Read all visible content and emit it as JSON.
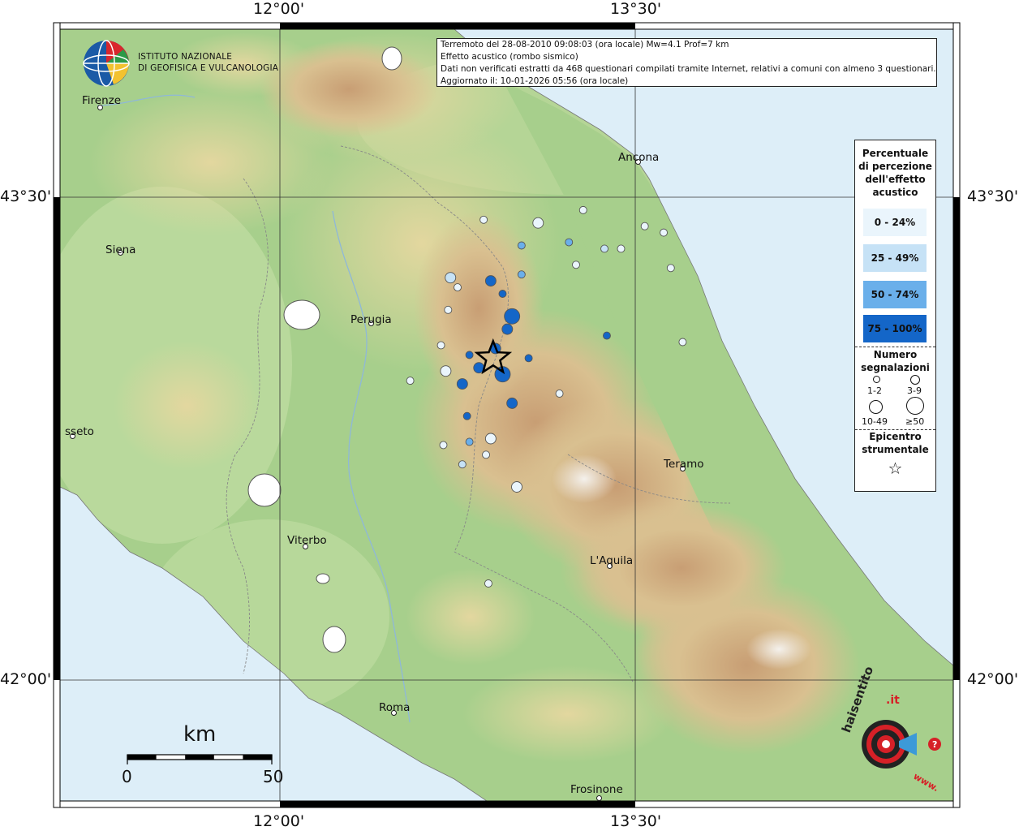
{
  "info": {
    "line1": "Terremoto del 28-08-2010 09:08:03 (ora locale) Mw=4.1 Prof=7 km",
    "line2": "Effetto acustico (rombo sismico)",
    "line3": "Dati non verificati estratti da 468 questionari compilati tramite Internet, relativi a comuni con almeno 3 questionari.",
    "line4": "Aggiornato il: 10-01-2026 05:56 (ora locale)"
  },
  "coords": {
    "top_left": "12°00'",
    "top_right": "13°30'",
    "bottom_left": "12°00'",
    "bottom_right": "13°30'",
    "left_top": "43°30'",
    "left_bottom": "42°00'",
    "right_top": "43°30'",
    "right_bottom": "42°00'"
  },
  "logo": {
    "line1": "ISTITUTO NAZIONALE",
    "line2": "DI GEOFISICA E VULCANOLOGIA"
  },
  "cities": {
    "firenze": "Firenze",
    "ancona": "Ancona",
    "siena": "Siena",
    "perugia": "Perugia",
    "grosseto": "sseto",
    "teramo": "Teramo",
    "viterbo": "Viterbo",
    "laquila": "L'Aquila",
    "roma": "Roma",
    "frosinone": "Frosinone"
  },
  "legend": {
    "title1": "Percentuale",
    "title2": "di percezione",
    "title3": "dell'effetto",
    "title4": "acustico",
    "classes": [
      {
        "label": "0 - 24%",
        "color": "#eaf5fc"
      },
      {
        "label": "25 - 49%",
        "color": "#c6e2f6"
      },
      {
        "label": "50 - 74%",
        "color": "#6aafea"
      },
      {
        "label": "75 - 100%",
        "color": "#1466c8"
      }
    ],
    "count_title1": "Numero",
    "count_title2": "segnalazioni",
    "count_labels": [
      "1-2",
      "3-9",
      "10-49",
      "≥50"
    ],
    "epi_title1": "Epicentro",
    "epi_title2": "strumentale",
    "star_glyph": "☆"
  },
  "scale": {
    "unit": "km",
    "min": "0",
    "max": "50"
  },
  "hsl": {
    "line1": "haisentito",
    "line2": "iltrerremoto",
    "domain": ".it",
    "prefix": "www."
  },
  "points": [
    {
      "lon": 12.94,
      "lat": 42.95,
      "pct": 100,
      "size": "large"
    },
    {
      "lon": 12.84,
      "lat": 42.97,
      "pct": 100,
      "size": "medium"
    },
    {
      "lon": 12.91,
      "lat": 43.03,
      "pct": 100,
      "size": "medium"
    },
    {
      "lon": 12.98,
      "lat": 43.13,
      "pct": 100,
      "size": "large"
    },
    {
      "lon": 12.96,
      "lat": 43.09,
      "pct": 100,
      "size": "medium"
    },
    {
      "lon": 12.98,
      "lat": 42.86,
      "pct": 100,
      "size": "medium"
    },
    {
      "lon": 12.89,
      "lat": 43.24,
      "pct": 100,
      "size": "medium"
    },
    {
      "lon": 13.05,
      "lat": 43.0,
      "pct": 100,
      "size": "small"
    },
    {
      "lon": 12.94,
      "lat": 43.2,
      "pct": 100,
      "size": "small"
    },
    {
      "lon": 12.8,
      "lat": 43.01,
      "pct": 100,
      "size": "small"
    },
    {
      "lon": 12.77,
      "lat": 42.92,
      "pct": 100,
      "size": "medium"
    },
    {
      "lon": 12.79,
      "lat": 42.82,
      "pct": 100,
      "size": "small"
    },
    {
      "lon": 13.38,
      "lat": 43.07,
      "pct": 100,
      "size": "small"
    },
    {
      "lon": 12.8,
      "lat": 42.74,
      "pct": 60,
      "size": "small"
    },
    {
      "lon": 13.02,
      "lat": 43.35,
      "pct": 60,
      "size": "small"
    },
    {
      "lon": 13.02,
      "lat": 43.26,
      "pct": 60,
      "size": "small"
    },
    {
      "lon": 13.22,
      "lat": 43.36,
      "pct": 60,
      "size": "small"
    },
    {
      "lon": 12.77,
      "lat": 42.67,
      "pct": 30,
      "size": "small"
    },
    {
      "lon": 12.72,
      "lat": 43.25,
      "pct": 30,
      "size": "medium"
    },
    {
      "lon": 13.37,
      "lat": 43.34,
      "pct": 30,
      "size": "small"
    },
    {
      "lon": 13.28,
      "lat": 43.46,
      "pct": 10,
      "size": "small"
    },
    {
      "lon": 12.86,
      "lat": 43.43,
      "pct": 10,
      "size": "small"
    },
    {
      "lon": 13.09,
      "lat": 43.42,
      "pct": 10,
      "size": "medium"
    },
    {
      "lon": 13.44,
      "lat": 43.34,
      "pct": 10,
      "size": "small"
    },
    {
      "lon": 13.54,
      "lat": 43.41,
      "pct": 10,
      "size": "small"
    },
    {
      "lon": 13.62,
      "lat": 43.39,
      "pct": 10,
      "size": "small"
    },
    {
      "lon": 13.25,
      "lat": 43.29,
      "pct": 10,
      "size": "small"
    },
    {
      "lon": 13.65,
      "lat": 43.28,
      "pct": 10,
      "size": "small"
    },
    {
      "lon": 12.75,
      "lat": 43.22,
      "pct": 10,
      "size": "small"
    },
    {
      "lon": 12.71,
      "lat": 43.15,
      "pct": 10,
      "size": "small"
    },
    {
      "lon": 12.68,
      "lat": 43.04,
      "pct": 10,
      "size": "small"
    },
    {
      "lon": 12.7,
      "lat": 42.96,
      "pct": 10,
      "size": "medium"
    },
    {
      "lon": 12.55,
      "lat": 42.93,
      "pct": 10,
      "size": "small"
    },
    {
      "lon": 13.7,
      "lat": 43.05,
      "pct": 10,
      "size": "small"
    },
    {
      "lon": 12.69,
      "lat": 42.73,
      "pct": 10,
      "size": "small"
    },
    {
      "lon": 12.89,
      "lat": 42.75,
      "pct": 10,
      "size": "medium"
    },
    {
      "lon": 12.87,
      "lat": 42.7,
      "pct": 10,
      "size": "small"
    },
    {
      "lon": 13.0,
      "lat": 42.6,
      "pct": 10,
      "size": "medium"
    },
    {
      "lon": 13.18,
      "lat": 42.89,
      "pct": 10,
      "size": "small"
    },
    {
      "lon": 12.88,
      "lat": 42.3,
      "pct": 10,
      "size": "small"
    }
  ],
  "epicenter": {
    "lon": 12.9,
    "lat": 43.0
  }
}
